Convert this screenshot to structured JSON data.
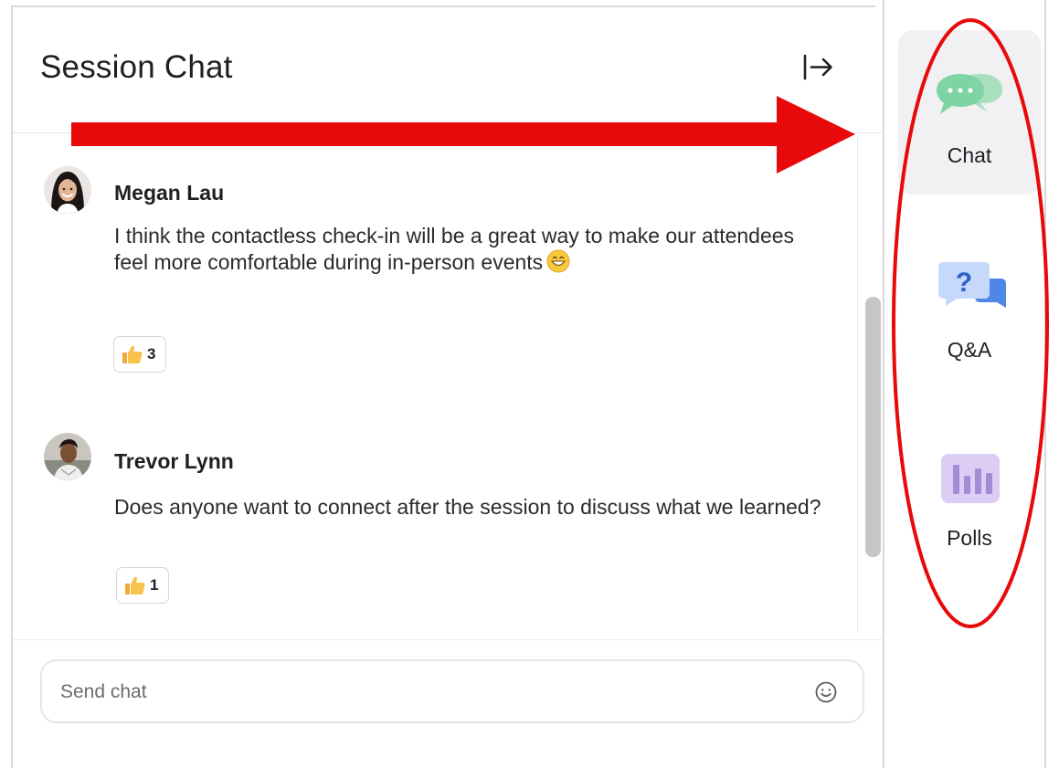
{
  "chat": {
    "title": "Session Chat",
    "collapse_icon": "collapse-right-icon",
    "messages": [
      {
        "author": "Megan Lau",
        "text": "I think the contactless check-in will be a great way to make our attendees feel more comfortable during in-person events",
        "inline_emoji": "grinning-face-emoji",
        "reaction_icon": "thumbs-up-icon",
        "reaction_count": "3"
      },
      {
        "author": "Trevor Lynn",
        "text": "Does anyone want to connect after the session to discuss what we learned?",
        "reaction_icon": "thumbs-up-icon",
        "reaction_count": "1"
      }
    ],
    "input": {
      "placeholder": "Send chat",
      "emoji_icon": "smiley-icon"
    }
  },
  "rail": {
    "items": [
      {
        "label": "Chat",
        "icon": "chat-bubbles-icon",
        "active": true
      },
      {
        "label": "Q&A",
        "icon": "question-bubble-icon",
        "active": false
      },
      {
        "label": "Polls",
        "icon": "bar-chart-icon",
        "active": false
      }
    ]
  },
  "colors": {
    "annotation_red": "#e8090b",
    "chat_icon_green": "#7fd4a3",
    "qa_icon_blue": "#5b8dee",
    "polls_icon_purple": "#a58ad6",
    "active_rail_bg": "#f1f1f3"
  }
}
